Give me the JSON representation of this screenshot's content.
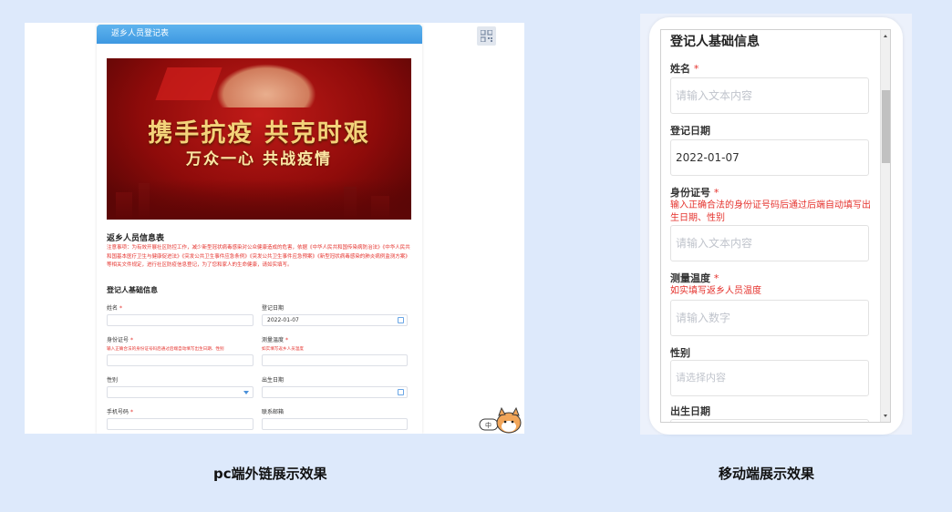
{
  "pc": {
    "header_title": "返乡人员登记表",
    "banner_line1": "携手抗疫 共克时艰",
    "banner_line2": "万众一心 共战疫情",
    "form_title": "返乡人员信息表",
    "notice": "注意事项：为有效开展社区防控工作，减少新型冠状病毒感染对公众健康造成的危害，依据《中华人民共和国传染病防治法》《中华人民共和国基本医疗卫生与健康促进法》《突发公共卫生事件应急条例》《突发公共卫生事件应急预案》《新型冠状病毒感染的肺炎病例监测方案》等相关文件规定，进行社区防疫信息登记，为了您和家人的生命健康，请如实填写。",
    "section_title": "登记人基础信息",
    "fields": {
      "name": {
        "label": "姓名",
        "required": "*"
      },
      "reg_date": {
        "label": "登记日期",
        "value": "2022-01-07"
      },
      "id_card": {
        "label": "身份证号",
        "required": "*",
        "hint": "输入正确合法的身份证号码后通过后端自动填写出生日期、性别"
      },
      "temperature": {
        "label": "测量温度",
        "required": "*",
        "hint": "如实填写返乡人员温度"
      },
      "gender": {
        "label": "性别"
      },
      "birth_date": {
        "label": "出生日期"
      },
      "phone": {
        "label": "手机号码",
        "required": "*"
      },
      "email": {
        "label": "联系邮箱"
      }
    }
  },
  "mobile": {
    "section_title": "登记人基础信息",
    "name_label": "姓名",
    "name_required": "*",
    "name_placeholder": "请输入文本内容",
    "reg_date_label": "登记日期",
    "reg_date_value": "2022-01-07",
    "id_label": "身份证号",
    "id_required": "*",
    "id_hint": "输入正确合法的身份证号码后通过后端自动填写出生日期、性别",
    "id_placeholder": "请输入文本内容",
    "temp_label": "测量温度",
    "temp_required": "*",
    "temp_hint": "如实填写返乡人员温度",
    "temp_placeholder": "请输入数字",
    "gender_label": "性别",
    "gender_placeholder": "请选择内容",
    "birth_label": "出生日期"
  },
  "captions": {
    "pc": "pc端外链展示效果",
    "mobile": "移动端展示效果"
  },
  "icons": {
    "qr": "qr-code-icon",
    "calendar": "calendar-icon",
    "dropdown": "chevron-down-icon"
  },
  "colors": {
    "header_blue": "#3d98e1",
    "required_red": "#e5322d",
    "page_bg": "#dde9fb"
  }
}
